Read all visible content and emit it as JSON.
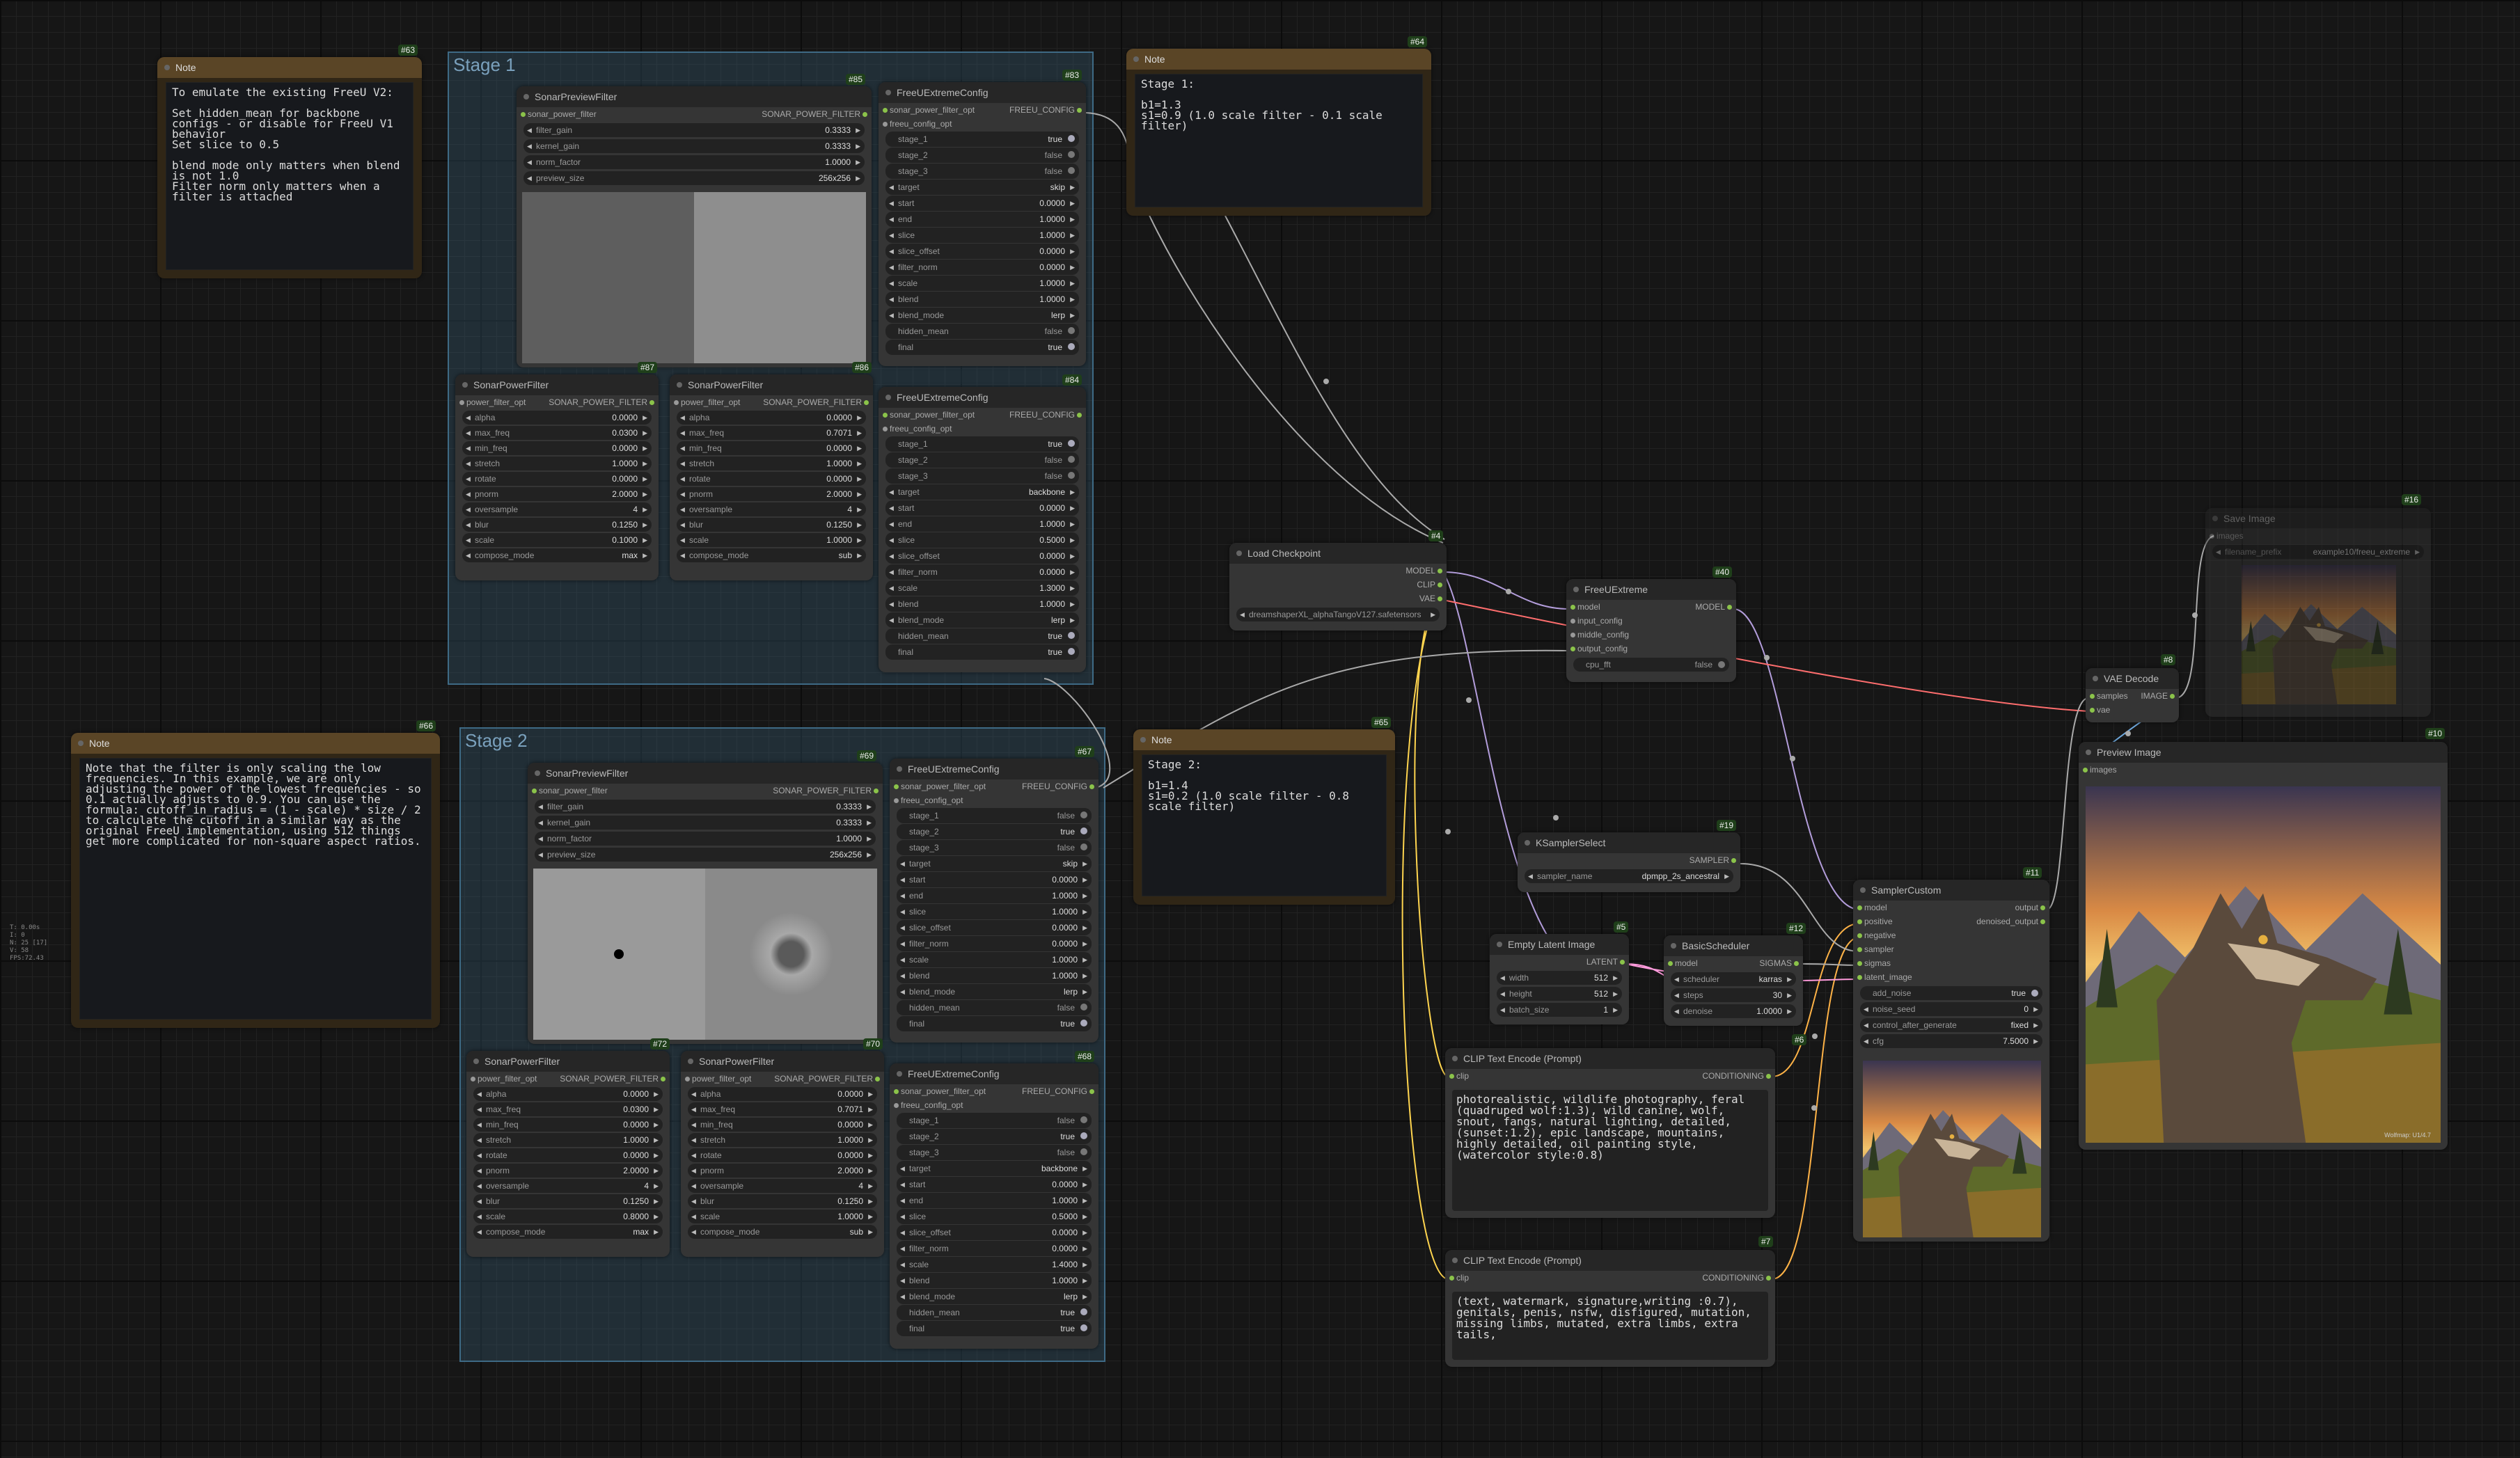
{
  "groups": {
    "stage1": "Stage 1",
    "stage2": "Stage 2"
  },
  "notes": {
    "n63": {
      "title": "Note",
      "id": "#63",
      "text": "To emulate the existing FreeU V2:\n\nSet hidden_mean for backbone configs - or disable for FreeU V1 behavior\nSet slice to 0.5\n\nblend mode only matters when blend is not 1.0\nFilter norm only matters when a filter is attached"
    },
    "n64": {
      "title": "Note",
      "id": "#64",
      "text": "Stage 1:\n\nb1=1.3\ns1=0.9 (1.0 scale filter - 0.1 scale filter)"
    },
    "n65": {
      "title": "Note",
      "id": "#65",
      "text": "Stage 2:\n\nb1=1.4\ns1=0.2 (1.0 scale filter - 0.8 scale filter)"
    },
    "n66": {
      "title": "Note",
      "id": "#66",
      "text": "Note that the filter is only scaling the low frequencies. In this example, we are only adjusting the power of the lowest frequencies - so 0.1 actually adjusts to 0.9. You can use the formula: cutoff_in_radius = (1 - scale) * size / 2 to calculate the cutoff in a similar way as the original FreeU implementation, using 512 things get more complicated for non-square aspect ratios."
    }
  },
  "stats": "T: 0.00s\nI: 0\nN: 25 [17]\nV: 58\nFPS:72.43",
  "nodes": {
    "n85": {
      "title": "SonarPreviewFilter",
      "id": "#85",
      "in": "sonar_power_filter",
      "out": "SONAR_POWER_FILTER",
      "w": [
        [
          "filter_gain",
          "0.3333"
        ],
        [
          "kernel_gain",
          "0.3333"
        ],
        [
          "norm_factor",
          "1.0000"
        ],
        [
          "preview_size",
          "256x256"
        ]
      ]
    },
    "n83": {
      "title": "FreeUExtremeConfig",
      "id": "#83",
      "in": "sonar_power_filter_opt",
      "in2": "freeu_config_opt",
      "out": "FREEU_CONFIG",
      "w": [
        [
          "stage_1",
          "true",
          1
        ],
        [
          "stage_2",
          "false",
          0
        ],
        [
          "stage_3",
          "false",
          0
        ],
        [
          "target",
          "skip"
        ],
        [
          "start",
          "0.0000"
        ],
        [
          "end",
          "1.0000"
        ],
        [
          "slice",
          "1.0000"
        ],
        [
          "slice_offset",
          "0.0000"
        ],
        [
          "filter_norm",
          "0.0000"
        ],
        [
          "scale",
          "1.0000"
        ],
        [
          "blend",
          "1.0000"
        ],
        [
          "blend_mode",
          "lerp"
        ],
        [
          "hidden_mean",
          "false",
          0
        ],
        [
          "final",
          "true",
          1
        ]
      ]
    },
    "n87": {
      "title": "SonarPowerFilter",
      "id": "#87",
      "in": "power_filter_opt",
      "out": "SONAR_POWER_FILTER",
      "w": [
        [
          "alpha",
          "0.0000"
        ],
        [
          "max_freq",
          "0.0300"
        ],
        [
          "min_freq",
          "0.0000"
        ],
        [
          "stretch",
          "1.0000"
        ],
        [
          "rotate",
          "0.0000"
        ],
        [
          "pnorm",
          "2.0000"
        ],
        [
          "oversample",
          "4"
        ],
        [
          "blur",
          "0.1250"
        ],
        [
          "scale",
          "0.1000"
        ],
        [
          "compose_mode",
          "max"
        ]
      ]
    },
    "n86": {
      "title": "SonarPowerFilter",
      "id": "#86",
      "in": "power_filter_opt",
      "out": "SONAR_POWER_FILTER",
      "w": [
        [
          "alpha",
          "0.0000"
        ],
        [
          "max_freq",
          "0.7071"
        ],
        [
          "min_freq",
          "0.0000"
        ],
        [
          "stretch",
          "1.0000"
        ],
        [
          "rotate",
          "0.0000"
        ],
        [
          "pnorm",
          "2.0000"
        ],
        [
          "oversample",
          "4"
        ],
        [
          "blur",
          "0.1250"
        ],
        [
          "scale",
          "1.0000"
        ],
        [
          "compose_mode",
          "sub"
        ]
      ]
    },
    "n84": {
      "title": "FreeUExtremeConfig",
      "id": "#84",
      "in": "sonar_power_filter_opt",
      "in2": "freeu_config_opt",
      "out": "FREEU_CONFIG",
      "w": [
        [
          "stage_1",
          "true",
          1
        ],
        [
          "stage_2",
          "false",
          0
        ],
        [
          "stage_3",
          "false",
          0
        ],
        [
          "target",
          "backbone"
        ],
        [
          "start",
          "0.0000"
        ],
        [
          "end",
          "1.0000"
        ],
        [
          "slice",
          "0.5000"
        ],
        [
          "slice_offset",
          "0.0000"
        ],
        [
          "filter_norm",
          "0.0000"
        ],
        [
          "scale",
          "1.3000"
        ],
        [
          "blend",
          "1.0000"
        ],
        [
          "blend_mode",
          "lerp"
        ],
        [
          "hidden_mean",
          "true",
          1
        ],
        [
          "final",
          "true",
          1
        ]
      ]
    },
    "n69": {
      "title": "SonarPreviewFilter",
      "id": "#69",
      "in": "sonar_power_filter",
      "out": "SONAR_POWER_FILTER",
      "w": [
        [
          "filter_gain",
          "0.3333"
        ],
        [
          "kernel_gain",
          "0.3333"
        ],
        [
          "norm_factor",
          "1.0000"
        ],
        [
          "preview_size",
          "256x256"
        ]
      ]
    },
    "n67": {
      "title": "FreeUExtremeConfig",
      "id": "#67",
      "in": "sonar_power_filter_opt",
      "in2": "freeu_config_opt",
      "out": "FREEU_CONFIG",
      "w": [
        [
          "stage_1",
          "false",
          0
        ],
        [
          "stage_2",
          "true",
          1
        ],
        [
          "stage_3",
          "false",
          0
        ],
        [
          "target",
          "skip"
        ],
        [
          "start",
          "0.0000"
        ],
        [
          "end",
          "1.0000"
        ],
        [
          "slice",
          "1.0000"
        ],
        [
          "slice_offset",
          "0.0000"
        ],
        [
          "filter_norm",
          "0.0000"
        ],
        [
          "scale",
          "1.0000"
        ],
        [
          "blend",
          "1.0000"
        ],
        [
          "blend_mode",
          "lerp"
        ],
        [
          "hidden_mean",
          "false",
          0
        ],
        [
          "final",
          "true",
          1
        ]
      ]
    },
    "n72": {
      "title": "SonarPowerFilter",
      "id": "#72",
      "in": "power_filter_opt",
      "out": "SONAR_POWER_FILTER",
      "w": [
        [
          "alpha",
          "0.0000"
        ],
        [
          "max_freq",
          "0.0300"
        ],
        [
          "min_freq",
          "0.0000"
        ],
        [
          "stretch",
          "1.0000"
        ],
        [
          "rotate",
          "0.0000"
        ],
        [
          "pnorm",
          "2.0000"
        ],
        [
          "oversample",
          "4"
        ],
        [
          "blur",
          "0.1250"
        ],
        [
          "scale",
          "0.8000"
        ],
        [
          "compose_mode",
          "max"
        ]
      ]
    },
    "n70": {
      "title": "SonarPowerFilter",
      "id": "#70",
      "in": "power_filter_opt",
      "out": "SONAR_POWER_FILTER",
      "w": [
        [
          "alpha",
          "0.0000"
        ],
        [
          "max_freq",
          "0.7071"
        ],
        [
          "min_freq",
          "0.0000"
        ],
        [
          "stretch",
          "1.0000"
        ],
        [
          "rotate",
          "0.0000"
        ],
        [
          "pnorm",
          "2.0000"
        ],
        [
          "oversample",
          "4"
        ],
        [
          "blur",
          "0.1250"
        ],
        [
          "scale",
          "1.0000"
        ],
        [
          "compose_mode",
          "sub"
        ]
      ]
    },
    "n68": {
      "title": "FreeUExtremeConfig",
      "id": "#68",
      "in": "sonar_power_filter_opt",
      "in2": "freeu_config_opt",
      "out": "FREEU_CONFIG",
      "w": [
        [
          "stage_1",
          "false",
          0
        ],
        [
          "stage_2",
          "true",
          1
        ],
        [
          "stage_3",
          "false",
          0
        ],
        [
          "target",
          "backbone"
        ],
        [
          "start",
          "0.0000"
        ],
        [
          "end",
          "1.0000"
        ],
        [
          "slice",
          "0.5000"
        ],
        [
          "slice_offset",
          "0.0000"
        ],
        [
          "filter_norm",
          "0.0000"
        ],
        [
          "scale",
          "1.4000"
        ],
        [
          "blend",
          "1.0000"
        ],
        [
          "blend_mode",
          "lerp"
        ],
        [
          "hidden_mean",
          "true",
          1
        ],
        [
          "final",
          "true",
          1
        ]
      ]
    },
    "n4": {
      "title": "Load Checkpoint",
      "id": "#4",
      "outs": [
        "MODEL",
        "CLIP",
        "VAE"
      ],
      "ckpt": "dreamshaperXL_alphaTangoV127.safetensors"
    },
    "n40": {
      "title": "FreeUExtreme",
      "id": "#40",
      "ins": [
        "model",
        "input_config",
        "middle_config",
        "output_config"
      ],
      "out": "MODEL",
      "w": [
        [
          "cpu_fft",
          "false",
          0
        ]
      ]
    },
    "n19": {
      "title": "KSamplerSelect",
      "id": "#19",
      "out": "SAMPLER",
      "w": [
        [
          "sampler_name",
          "dpmpp_2s_ancestral"
        ]
      ]
    },
    "n5": {
      "title": "Empty Latent Image",
      "id": "#5",
      "out": "LATENT",
      "w": [
        [
          "width",
          "512"
        ],
        [
          "height",
          "512"
        ],
        [
          "batch_size",
          "1"
        ]
      ]
    },
    "n12": {
      "title": "BasicScheduler",
      "id": "#12",
      "in": "model",
      "out": "SIGMAS",
      "w": [
        [
          "scheduler",
          "karras"
        ],
        [
          "steps",
          "30"
        ],
        [
          "denoise",
          "1.0000"
        ]
      ]
    },
    "n11": {
      "title": "SamplerCustom",
      "id": "#11",
      "ins": [
        "model",
        "positive",
        "negative",
        "sampler",
        "sigmas",
        "latent_image"
      ],
      "outs": [
        "output",
        "denoised_output"
      ],
      "w": [
        [
          "add_noise",
          "true",
          1
        ],
        [
          "noise_seed",
          "0"
        ],
        [
          "control_after_generate",
          "fixed"
        ],
        [
          "cfg",
          "7.5000"
        ]
      ]
    },
    "n6": {
      "title": "CLIP Text Encode (Prompt)",
      "id": "#6",
      "in": "clip",
      "out": "CONDITIONING",
      "text": "photorealistic, wildlife photography, feral (quadruped wolf:1.3), wild canine, wolf, snout, fangs, natural lighting, detailed, (sunset:1.2), epic landscape, mountains, highly detailed, oil painting style, (watercolor style:0.8)"
    },
    "n7": {
      "title": "CLIP Text Encode (Prompt)",
      "id": "#7",
      "in": "clip",
      "out": "CONDITIONING",
      "text": "(text, watermark, signature,writing :0.7), genitals, penis, nsfw, disfigured, mutation, missing limbs, mutated, extra limbs, extra tails,"
    },
    "n8": {
      "title": "VAE Decode",
      "id": "#8",
      "ins": [
        "samples",
        "vae"
      ],
      "out": "IMAGE"
    },
    "n10": {
      "title": "Preview Image",
      "id": "#10",
      "in": "images",
      "watermark": "Wolfmap: U1/4.7"
    },
    "n16": {
      "title": "Save Image",
      "id": "#16",
      "in": "images",
      "w": [
        [
          "filename_prefix",
          "example10/freeu_extreme"
        ]
      ]
    }
  },
  "colors": {
    "wire_model": "#b39ddb",
    "wire_clip": "#ffd54f",
    "wire_vae": "#ff6e6e",
    "wire_generic": "#aaaaaa",
    "group": "#3e6a85",
    "note": "#5a4526"
  }
}
